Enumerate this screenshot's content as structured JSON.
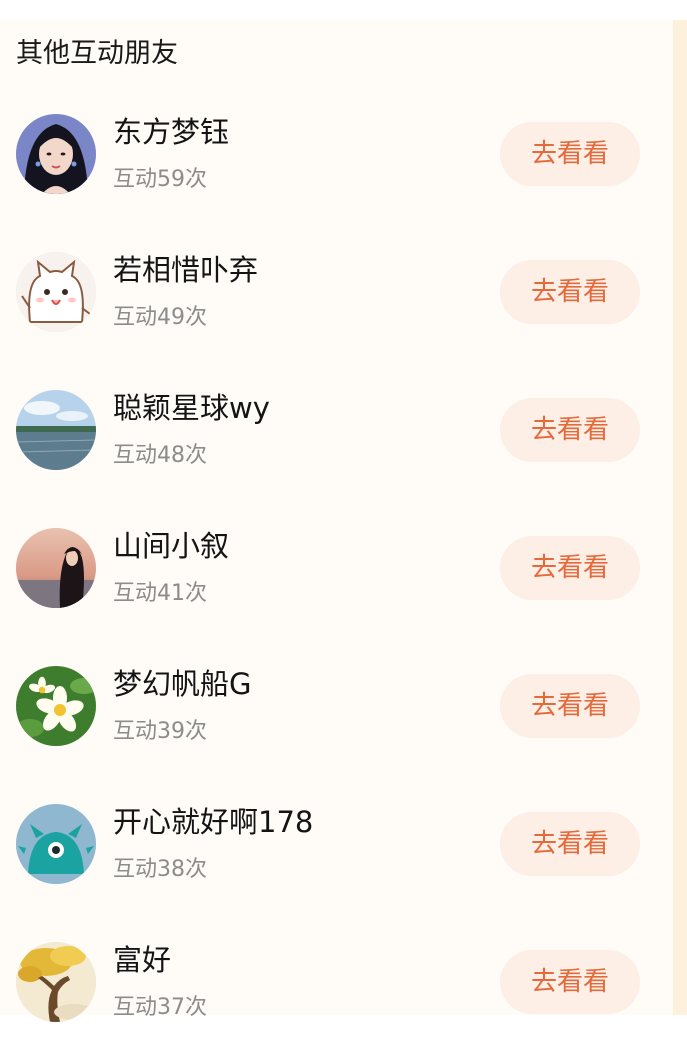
{
  "section": {
    "title": "其他互动朋友"
  },
  "colors": {
    "button_bg": "#fdeee6",
    "button_text": "#e46a3c",
    "count_text": "#8c8c8c",
    "panel_bg": "#fffbf7"
  },
  "friends": [
    {
      "name": "东方梦钰",
      "interactions": "互动59次",
      "action": "去看看",
      "avatar": "woman-portrait-avatar"
    },
    {
      "name": "若相惜卟弃",
      "interactions": "互动49次",
      "action": "去看看",
      "avatar": "cartoon-cat-avatar"
    },
    {
      "name": "聪颖星球wy",
      "interactions": "互动48次",
      "action": "去看看",
      "avatar": "lake-landscape-avatar"
    },
    {
      "name": "山间小叙",
      "interactions": "互动41次",
      "action": "去看看",
      "avatar": "sunset-girl-avatar"
    },
    {
      "name": "梦幻帆船G",
      "interactions": "互动39次",
      "action": "去看看",
      "avatar": "frangipani-flower-avatar"
    },
    {
      "name": "开心就好啊178",
      "interactions": "互动38次",
      "action": "去看看",
      "avatar": "teal-monster-avatar"
    },
    {
      "name": "富好",
      "interactions": "互动37次",
      "action": "去看看",
      "avatar": "golden-tree-avatar"
    }
  ]
}
